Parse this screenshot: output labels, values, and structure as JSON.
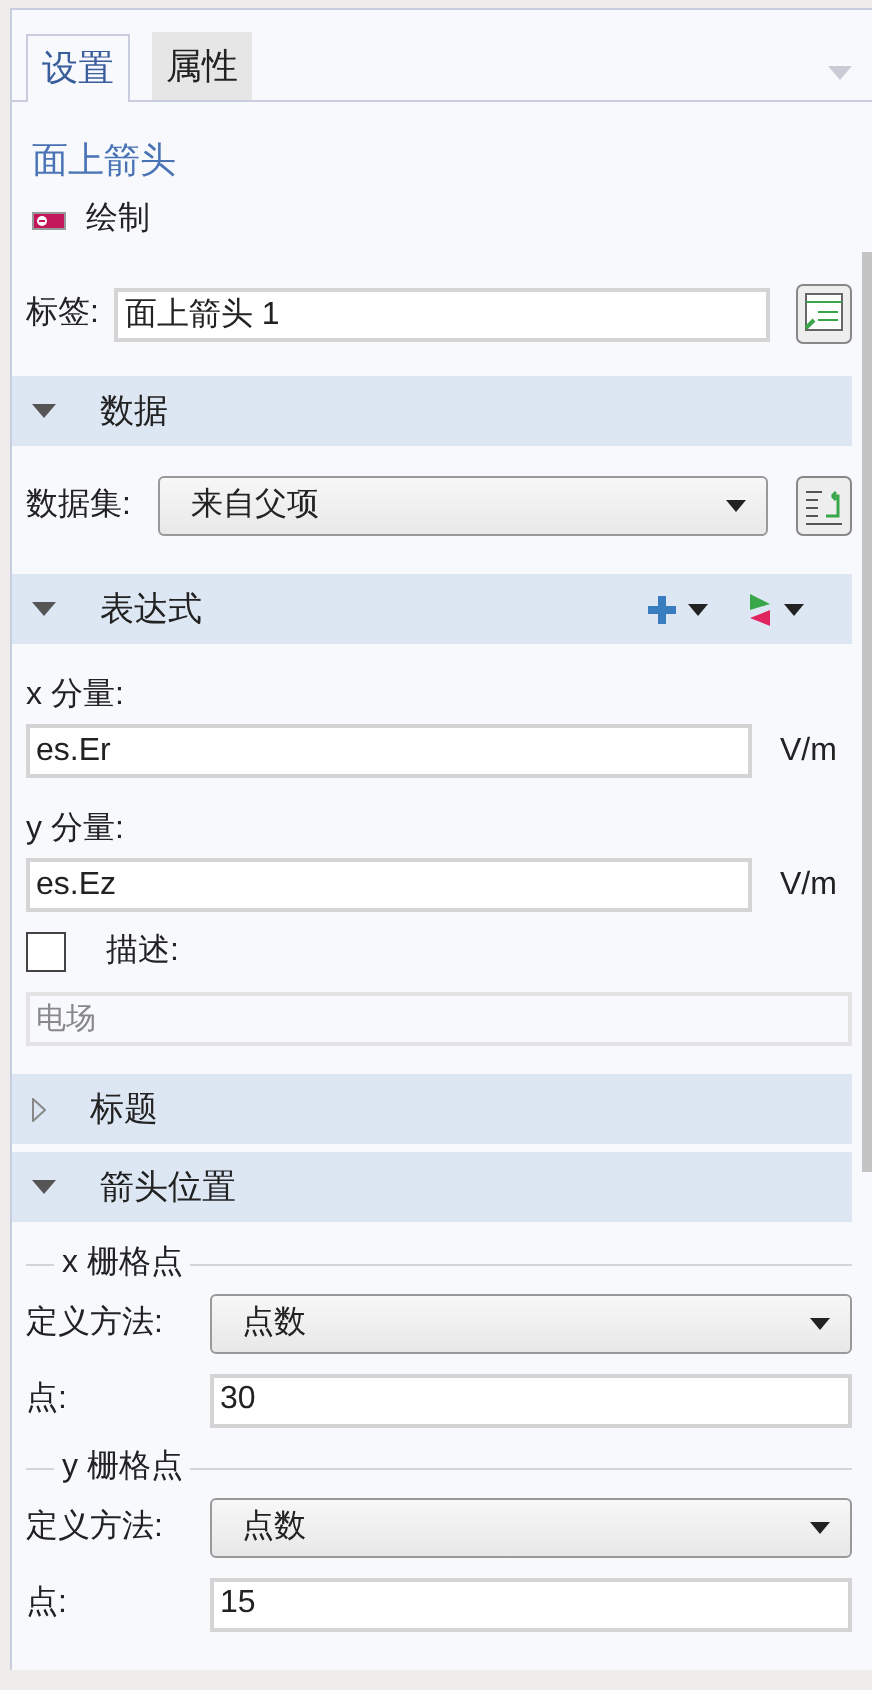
{
  "tabs": [
    {
      "label": "设置",
      "selected": true
    },
    {
      "label": "属性",
      "selected": false
    }
  ],
  "header": {
    "title": "面上箭头",
    "subtitle": "绘制"
  },
  "label_row": {
    "label": "标签:",
    "value": "面上箭头 1"
  },
  "sections": [
    {
      "kind": "data",
      "title": "数据",
      "expanded": true,
      "dataset_label": "数据集:",
      "dataset_value": "来自父项"
    },
    {
      "kind": "expression",
      "title": "表达式",
      "expanded": true,
      "components": [
        {
          "label": "x 分量:",
          "value": "es.Er",
          "unit": "V/m"
        },
        {
          "label": "y 分量:",
          "value": "es.Ez",
          "unit": "V/m"
        }
      ],
      "description": {
        "label": "描述:",
        "checked": false,
        "value": "电场",
        "disabled": true
      }
    },
    {
      "kind": "title",
      "title": "标题",
      "expanded": false
    },
    {
      "kind": "arrow_position",
      "title": "箭头位置",
      "expanded": true,
      "groups": [
        {
          "title": "x 栅格点",
          "method_label": "定义方法:",
          "method_value": "点数",
          "points_label": "点:",
          "points_value": "30"
        },
        {
          "title": "y 栅格点",
          "method_label": "定义方法:",
          "method_value": "点数",
          "points_label": "点:",
          "points_value": "15"
        }
      ]
    }
  ]
}
